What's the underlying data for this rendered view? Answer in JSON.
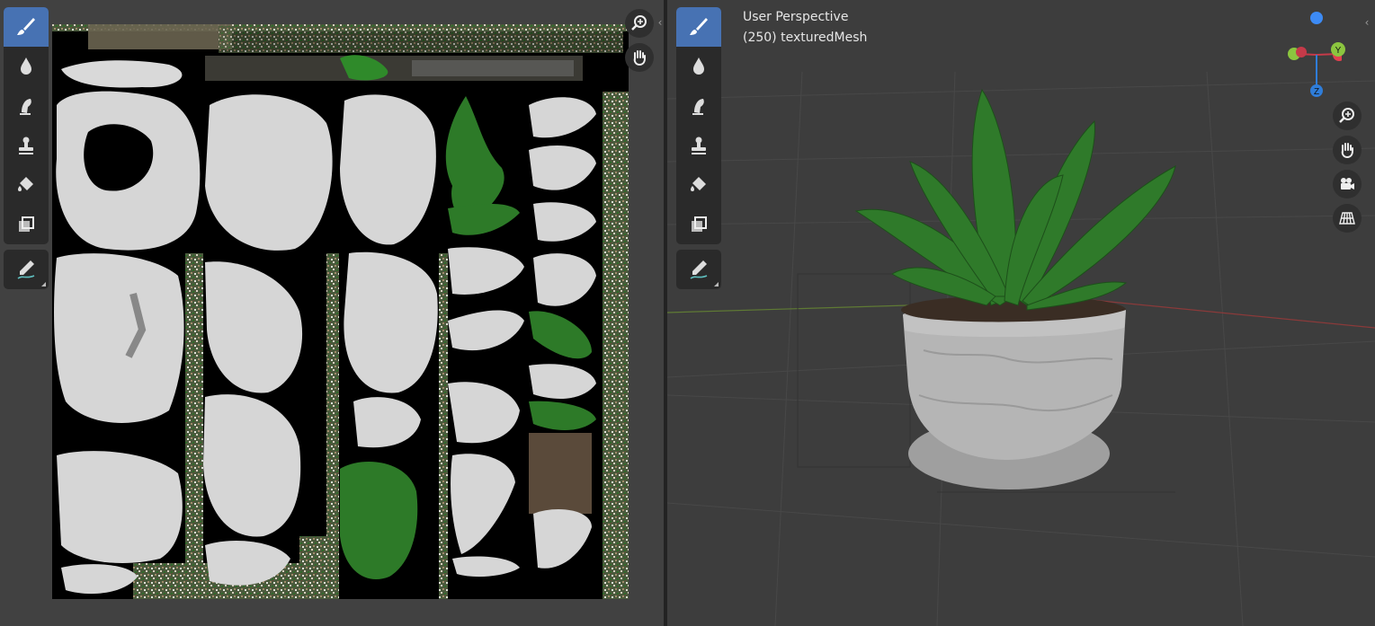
{
  "image_editor": {
    "tools": [
      {
        "name": "draw-tool",
        "icon": "brush-icon",
        "active": true
      },
      {
        "name": "soften-tool",
        "icon": "drop-icon"
      },
      {
        "name": "smear-tool",
        "icon": "smear-icon"
      },
      {
        "name": "clone-tool",
        "icon": "stamp-icon"
      },
      {
        "name": "fill-tool",
        "icon": "bucket-icon"
      },
      {
        "name": "mask-tool",
        "icon": "mask-icon"
      },
      {
        "name": "annotate-tool",
        "icon": "annotate-pen-icon"
      }
    ],
    "nav": [
      "zoom-icon",
      "hand-pan-icon"
    ]
  },
  "viewport": {
    "view_name": "User Perspective",
    "object_info": "(250) texturedMesh",
    "gizmo_axes": {
      "x": "X",
      "y": "Y",
      "z": "Z"
    },
    "axis_colors": {
      "x": "#e3404f",
      "y": "#8bc53f",
      "z": "#2f7dd9",
      "dot": "#3d8bf5"
    },
    "nav": [
      "zoom-icon",
      "hand-pan-icon",
      "camera-icon",
      "grid-ortho-icon"
    ]
  },
  "colors": {
    "accent": "#4772b3",
    "plant_green": "#2f7a2a",
    "pot_grey": "#b5b5b5"
  }
}
